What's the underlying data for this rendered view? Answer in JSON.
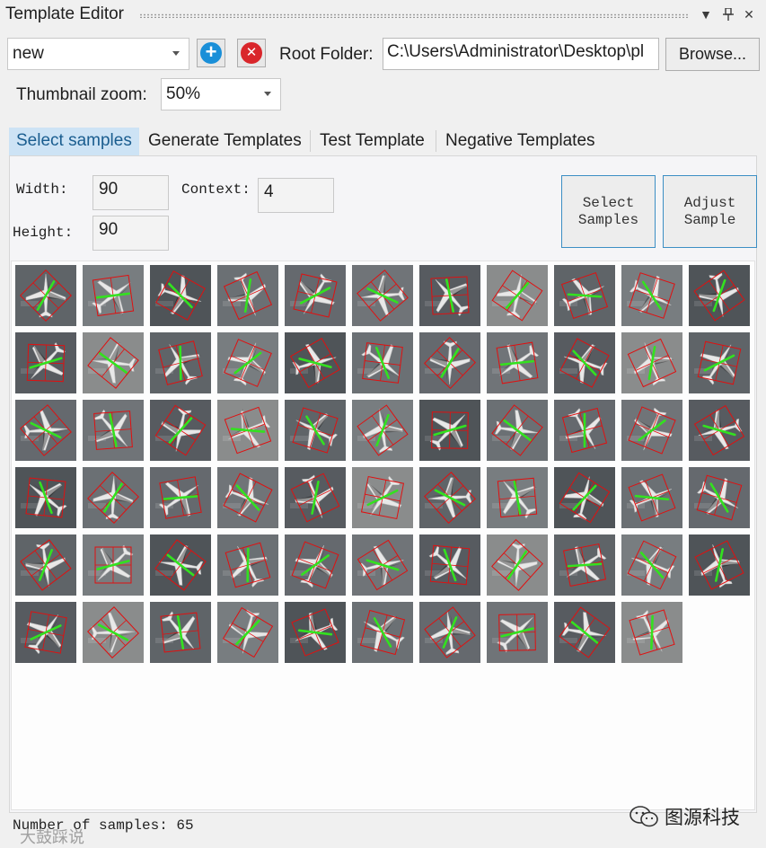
{
  "window": {
    "title": "Template Editor"
  },
  "toolbar": {
    "template_select": "new",
    "add_symbol": "+",
    "remove_symbol": "✕",
    "root_folder_label": "Root Folder:",
    "root_folder_value": "C:\\Users\\Administrator\\Desktop\\pl",
    "browse_label": "Browse...",
    "zoom_label": "Thumbnail zoom:",
    "zoom_value": "50%"
  },
  "tabs": [
    {
      "label": "Select samples",
      "active": true
    },
    {
      "label": "Generate Templates",
      "active": false
    },
    {
      "label": "Test Template",
      "active": false
    },
    {
      "label": "Negative Templates",
      "active": false
    }
  ],
  "params": {
    "width_label": "Width:",
    "width_value": "90",
    "height_label": "Height:",
    "height_value": "90",
    "context_label": "Context:",
    "context_value": "4"
  },
  "buttons": {
    "select_samples": "Select\nSamples",
    "adjust_sample": "Adjust\nSample"
  },
  "samples": {
    "count": 65,
    "columns": 11
  },
  "status": {
    "text": "Number of samples: 65"
  },
  "watermark": {
    "text": "图源科技",
    "text2": "大鼓踩说"
  },
  "colors": {
    "accent": "#1a5d8f",
    "tab_active_bg": "#cde3f5",
    "box_red": "#e01010",
    "sample_green": "#33e11f",
    "add_blue": "#1a8fd8",
    "remove_red": "#d9262b"
  }
}
